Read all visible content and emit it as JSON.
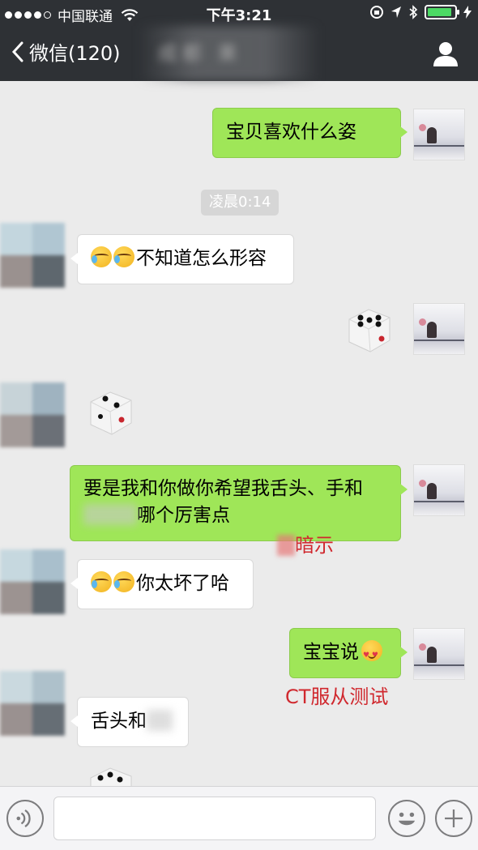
{
  "status_bar": {
    "carrier": "中国联通",
    "time": "下午3:21",
    "battery_level": 0.9,
    "battery_color": "#4cd964"
  },
  "nav": {
    "back_label": "微信(120)",
    "title": "成都 果",
    "back_icon": "chevron-left-icon",
    "profile_icon": "person-icon"
  },
  "chat": {
    "timestamp": "凌晨0:14",
    "messages": [
      {
        "from": "me",
        "text": "宝贝喜欢什么姿"
      },
      {
        "from": "other",
        "text": "不知道怎么形容",
        "emoji": [
          "cry",
          "cry"
        ]
      },
      {
        "from": "me",
        "type": "dice"
      },
      {
        "from": "other",
        "type": "dice"
      },
      {
        "from": "me",
        "line1": "要是我和你做你希望我舌头、手和",
        "line2": "哪个厉害点"
      },
      {
        "from": "other",
        "text": "你太坏了哈",
        "emoji": [
          "cry",
          "cry"
        ]
      },
      {
        "from": "me",
        "text": "宝宝说",
        "emoji_after": "love"
      },
      {
        "from": "other",
        "text": "舌头和"
      },
      {
        "from": "other",
        "type": "dice"
      }
    ],
    "annotations": {
      "hint": "暗示",
      "test": "CT服从测试"
    },
    "bubble_out_color": "#9fe658",
    "bubble_in_color": "#ffffff"
  },
  "input_bar": {
    "voice_icon": "voice-icon",
    "emoji_icon": "emoji-icon",
    "plus_icon": "plus-icon"
  }
}
